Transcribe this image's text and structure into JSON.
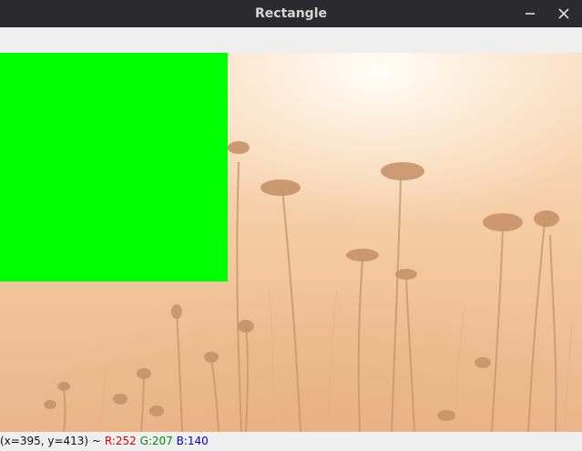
{
  "window": {
    "title": "Rectangle"
  },
  "title_buttons": {
    "minimize_icon": "minimize-icon",
    "close_icon": "close-icon"
  },
  "drawn_rectangle": {
    "color": "#00ff00"
  },
  "status": {
    "coords": "(x=395, y=413) ~",
    "r_label": "R:252",
    "g_label": "G:207",
    "b_label": "B:140",
    "r_color": "#e00000",
    "g_color": "#009000",
    "b_color": "#0000d0"
  }
}
